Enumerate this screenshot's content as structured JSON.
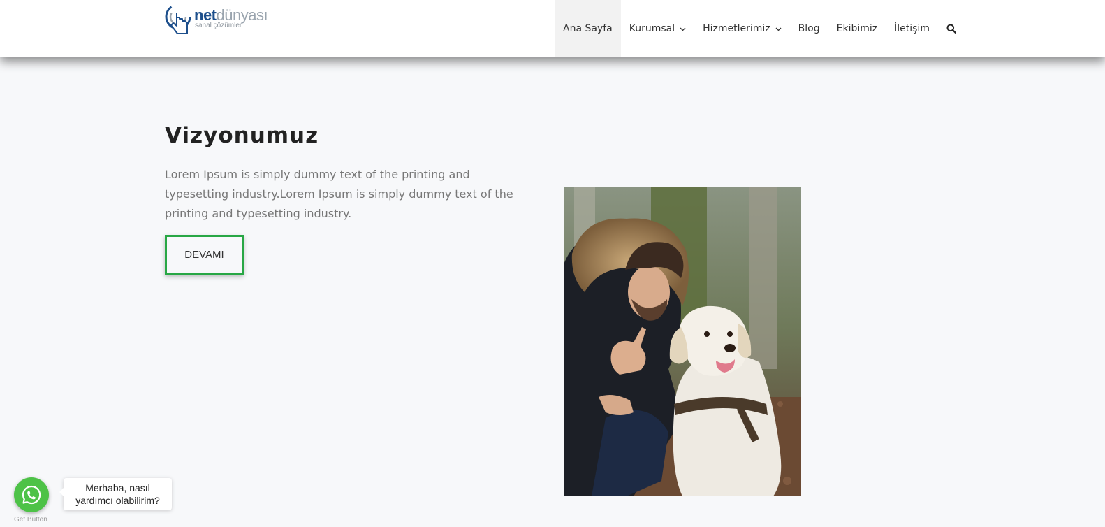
{
  "header": {
    "logo": {
      "brand_bold": "net",
      "brand_light": "dünyası",
      "tagline": "sanal çözümler",
      "icon": "hand-pointer-logo-icon",
      "colors": {
        "primary": "#1d4f8c",
        "secondary": "#9aa4ae"
      }
    },
    "nav": {
      "items": [
        {
          "label": "Ana Sayfa",
          "active": true,
          "has_dropdown": false
        },
        {
          "label": "Kurumsal",
          "active": false,
          "has_dropdown": true
        },
        {
          "label": "Hizmetlerimiz",
          "active": false,
          "has_dropdown": true
        },
        {
          "label": "Blog",
          "active": false,
          "has_dropdown": false
        },
        {
          "label": "Ekibimiz",
          "active": false,
          "has_dropdown": false
        },
        {
          "label": "İletişim",
          "active": false,
          "has_dropdown": false
        }
      ],
      "search_icon": "search-icon"
    }
  },
  "main": {
    "title": "Vizyonumuz",
    "description": "Lorem Ipsum is simply dummy text of the printing and typesetting industry.Lorem Ipsum is simply dummy text of the printing and typesetting industry.",
    "button_label": "DEVAMI",
    "button_color": "#28a745",
    "image_subject": "man-with-dog-photo"
  },
  "whatsapp": {
    "icon": "whatsapp-icon",
    "caption": "Get Button",
    "bubble_line1": "Merhaba, nasıl",
    "bubble_line2": "yardımcı olabilirim?",
    "color": "#4dc247"
  }
}
